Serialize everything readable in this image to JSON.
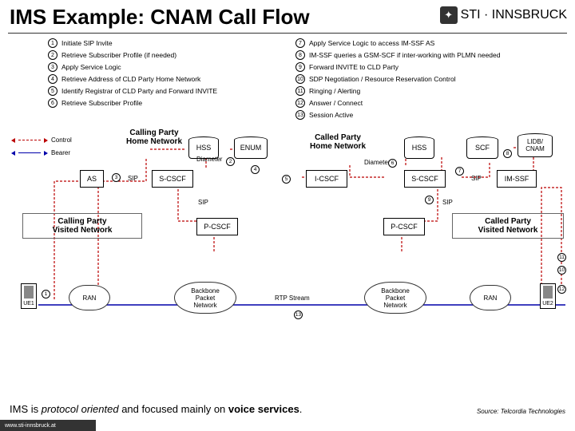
{
  "title": "IMS Example: CNAM Call Flow",
  "logo": {
    "icon": "running-icon",
    "text": "STI · INNSBRUCK"
  },
  "steps_left": [
    {
      "n": "1",
      "t": "Initiate SIP Invite"
    },
    {
      "n": "2",
      "t": "Retrieve Subscriber Profile (if needed)"
    },
    {
      "n": "3",
      "t": "Apply Service Logic"
    },
    {
      "n": "4",
      "t": "Retrieve Address of CLD Party Home Network"
    },
    {
      "n": "5",
      "t": "Identify Registrar of CLD Party and Forward INVITE"
    },
    {
      "n": "6",
      "t": "Retrieve Subscriber Profile"
    }
  ],
  "steps_right": [
    {
      "n": "7",
      "t": "Apply Service Logic to access IM-SSF AS"
    },
    {
      "n": "8",
      "t": "IM-SSF queries a GSM-SCF if inter-working with PLMN needed"
    },
    {
      "n": "9",
      "t": "Forward INVITE to CLD Party"
    },
    {
      "n": "10",
      "t": "SDP Negotiation / Resource Reservation Control"
    },
    {
      "n": "11",
      "t": "Ringing / Alerting"
    },
    {
      "n": "12",
      "t": "Answer / Connect"
    },
    {
      "n": "13",
      "t": "Session Active"
    }
  ],
  "legend": {
    "control": "Control",
    "bearer": "Bearer"
  },
  "nodes": {
    "calling_home": "Calling Party\nHome Network",
    "called_home": "Called Party\nHome Network",
    "calling_visited": "Calling Party\nVisited Network",
    "called_visited": "Called Party\nVisited Network",
    "hss1": "HSS",
    "hss2": "HSS",
    "enum": "ENUM",
    "scf": "SCF",
    "lidb": "LIDB/\nCNAM",
    "as": "AS",
    "scscf1": "S-CSCF",
    "scscf2": "S-CSCF",
    "icscf": "I-CSCF",
    "imssf": "IM-SSF",
    "pcscf1": "P-CSCF",
    "pcscf2": "P-CSCF",
    "ran1": "RAN",
    "ran2": "RAN",
    "bpn1": "Backbone\nPacket\nNetwork",
    "bpn2": "Backbone\nPacket\nNetwork",
    "ue1": "UE1",
    "ue2": "UE2"
  },
  "labels": {
    "diameter": "Diameter",
    "sip": "SIP",
    "rtp": "RTP Stream"
  },
  "caption": "IMS is protocol oriented and focused mainly on voice services.",
  "source": "Source: Telcordia Technologies",
  "footer_url": "www.sti-innsbruck.at"
}
